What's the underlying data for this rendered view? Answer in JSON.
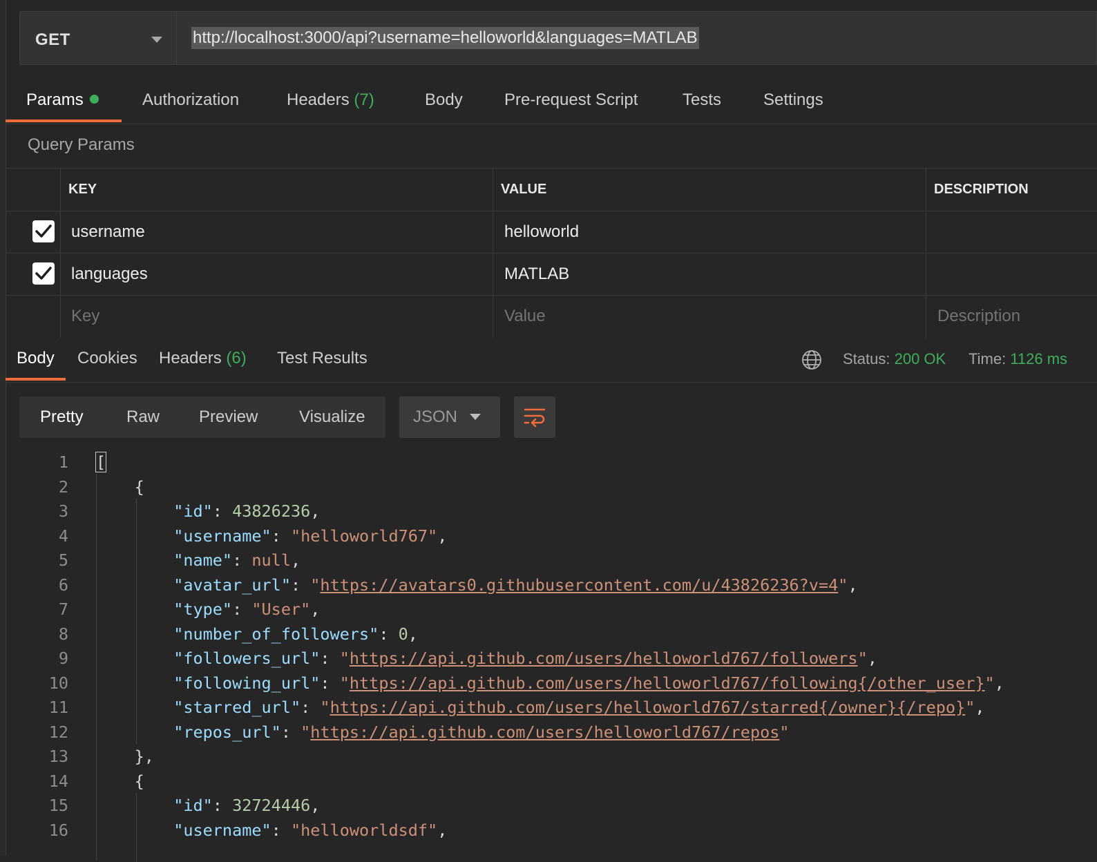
{
  "request": {
    "method": "GET",
    "url": "http://localhost:3000/api?username=helloworld&languages=MATLAB"
  },
  "request_tabs": {
    "params": "Params",
    "authorization": "Authorization",
    "headers": "Headers",
    "headers_count": "(7)",
    "body": "Body",
    "prerequest": "Pre-request Script",
    "tests": "Tests",
    "settings": "Settings"
  },
  "query_params": {
    "title": "Query Params",
    "columns": {
      "key": "KEY",
      "value": "VALUE",
      "description": "DESCRIPTION"
    },
    "rows": [
      {
        "checked": true,
        "key": "username",
        "value": "helloworld",
        "description": ""
      },
      {
        "checked": true,
        "key": "languages",
        "value": "MATLAB",
        "description": ""
      }
    ],
    "placeholders": {
      "key": "Key",
      "value": "Value",
      "description": "Description"
    }
  },
  "response_tabs": {
    "body": "Body",
    "cookies": "Cookies",
    "headers": "Headers",
    "headers_count": "(6)",
    "test_results": "Test Results"
  },
  "response_status": {
    "status_label": "Status:",
    "status_value": "200 OK",
    "time_label": "Time:",
    "time_value": "1126 ms"
  },
  "body_view": {
    "pretty": "Pretty",
    "raw": "Raw",
    "preview": "Preview",
    "visualize": "Visualize",
    "format": "JSON"
  },
  "code_lines": [
    {
      "n": "1",
      "open": "["
    },
    {
      "n": "2",
      "brace": "{"
    },
    {
      "n": "3",
      "key": "\"id\"",
      "num": "43826236",
      "end": ","
    },
    {
      "n": "4",
      "key": "\"username\"",
      "str": "\"helloworld767\"",
      "end": ","
    },
    {
      "n": "5",
      "key": "\"name\"",
      "nul": "null",
      "end": ","
    },
    {
      "n": "6",
      "key": "\"avatar_url\"",
      "url": "https://avatars0.githubusercontent.com/u/43826236?v=4",
      "end": ","
    },
    {
      "n": "7",
      "key": "\"type\"",
      "str": "\"User\"",
      "end": ","
    },
    {
      "n": "8",
      "key": "\"number_of_followers\"",
      "num": "0",
      "end": ","
    },
    {
      "n": "9",
      "key": "\"followers_url\"",
      "url": "https://api.github.com/users/helloworld767/followers",
      "end": ","
    },
    {
      "n": "10",
      "key": "\"following_url\"",
      "url": "https://api.github.com/users/helloworld767/following{/other_user}",
      "end": ","
    },
    {
      "n": "11",
      "key": "\"starred_url\"",
      "url": "https://api.github.com/users/helloworld767/starred{/owner}{/repo}",
      "end": ","
    },
    {
      "n": "12",
      "key": "\"repos_url\"",
      "url": "https://api.github.com/users/helloworld767/repos",
      "end": ""
    },
    {
      "n": "13",
      "brace": "},",
      "end": ""
    },
    {
      "n": "14",
      "brace": "{"
    },
    {
      "n": "15",
      "key": "\"id\"",
      "num": "32724446",
      "end": ","
    },
    {
      "n": "16",
      "key": "\"username\"",
      "str": "\"helloworldsdf\"",
      "end": ","
    }
  ],
  "colors": {
    "accent": "#f26b3a",
    "success": "#3fae5a",
    "json_key": "#9cdcfe",
    "json_string": "#ce9178",
    "json_number": "#b5cea8"
  }
}
